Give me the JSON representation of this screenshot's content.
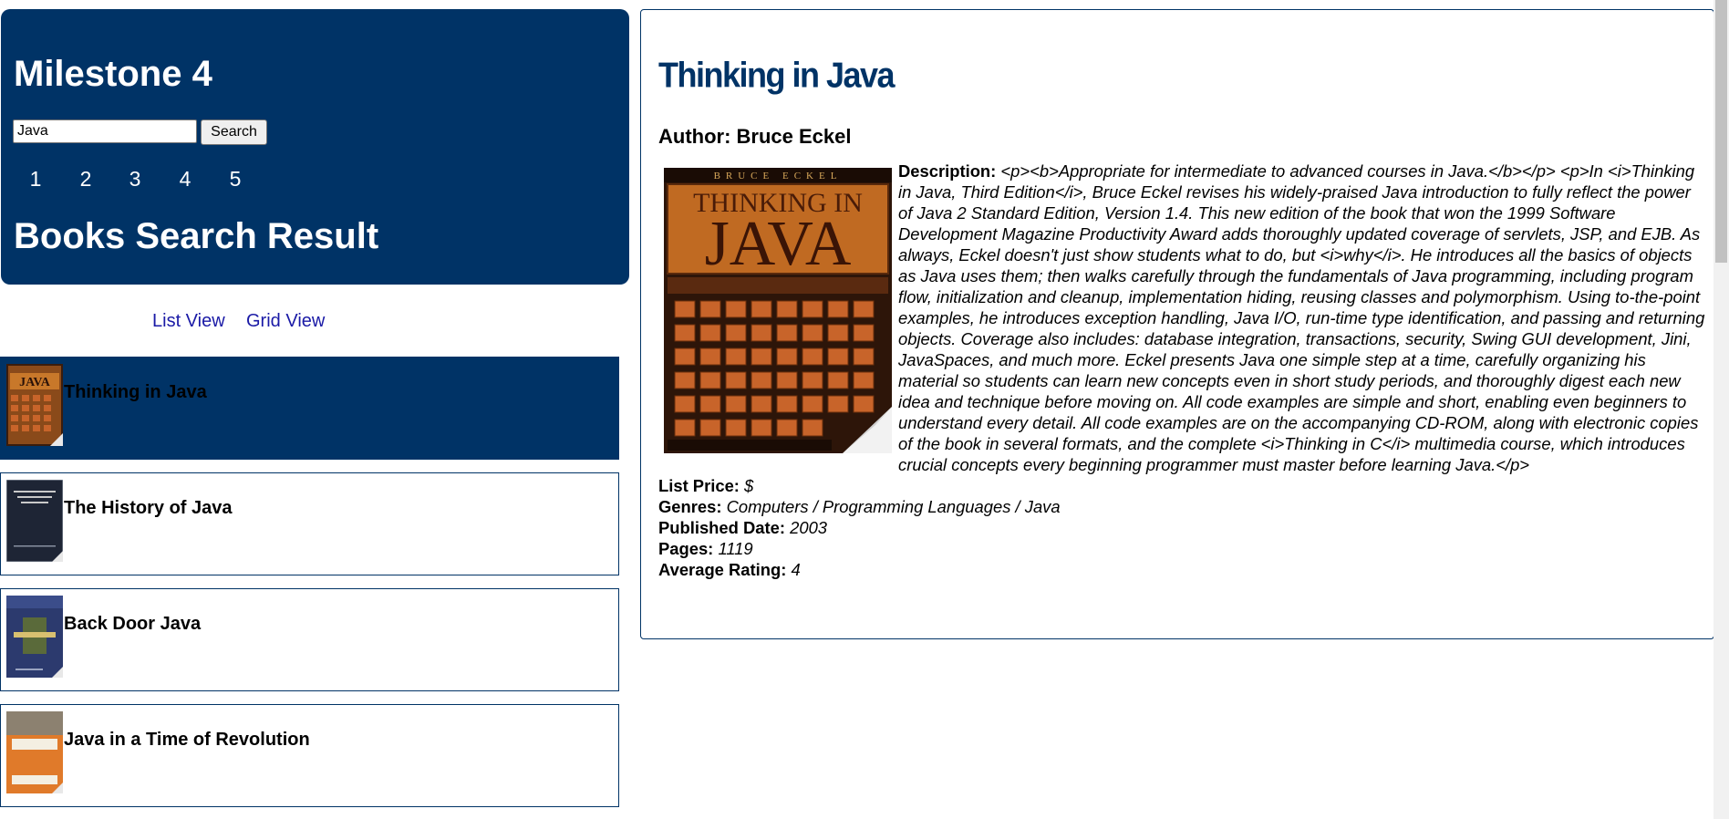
{
  "header": {
    "app_title": "Milestone 4",
    "search_value": "Java",
    "search_button": "Search",
    "pages": [
      "1",
      "2",
      "3",
      "4",
      "5"
    ],
    "results_heading": "Books Search Result"
  },
  "views": {
    "list_view": "List View",
    "grid_view": "Grid View"
  },
  "books": [
    {
      "title": "Thinking in Java",
      "cover": "thinking-in-java-cover"
    },
    {
      "title": "The History of Java",
      "cover": "history-of-java-cover"
    },
    {
      "title": "Back Door Java",
      "cover": "back-door-java-cover"
    },
    {
      "title": "Java in a Time of Revolution",
      "cover": "java-time-of-revolution-cover"
    }
  ],
  "detail": {
    "title": "Thinking in Java",
    "author": "Author: Bruce Eckel",
    "description_label": "Description:",
    "description": "<p><b>Appropriate for intermediate to advanced courses in Java.</b></p> <p>In <i>Thinking in Java, Third Edition</i>, Bruce Eckel revises his widely-praised Java introduction to fully reflect the power of Java 2 Standard Edition, Version 1.4. This new edition of the book that won the 1999 Software Development Magazine Productivity Award adds thoroughly updated coverage of servlets, JSP, and EJB. As always, Eckel doesn't just show students what to do, but <i>why</i>. He introduces all the basics of objects as Java uses them; then walks carefully through the fundamentals of Java programming, including program flow, initialization and cleanup, implementation hiding, reusing classes and polymorphism. Using to-the-point examples, he introduces exception handling, Java I/O, run-time type identification, and passing and returning objects. Coverage also includes: database integration, transactions, security, Swing GUI development, Jini, JavaSpaces, and much more. Eckel presents Java one simple step at a time, carefully organizing his material so students can learn new concepts even in short study periods, and thoroughly digest each new idea and technique before moving on. All code examples are simple and short, enabling even beginners to understand every detail. All code examples are on the accompanying CD-ROM, along with electronic copies of the book in several formats, and the complete <i>Thinking in C</i> multimedia course, which introduces crucial concepts every beginning programmer must master before learning Java.</p>",
    "list_price_label": "List Price:",
    "list_price": "$",
    "genres_label": "Genres:",
    "genres": "Computers / Programming Languages / Java",
    "published_label": "Published Date:",
    "published": "2003",
    "pages_label": "Pages:",
    "pages": "1119",
    "rating_label": "Average Rating:",
    "rating": "4",
    "cover": {
      "author_band": "BRUCE ECKEL",
      "title_top": "THINKING IN",
      "title_big": "JAVA"
    }
  },
  "colors": {
    "brand": "#003366",
    "link": "#1a1aa6"
  }
}
